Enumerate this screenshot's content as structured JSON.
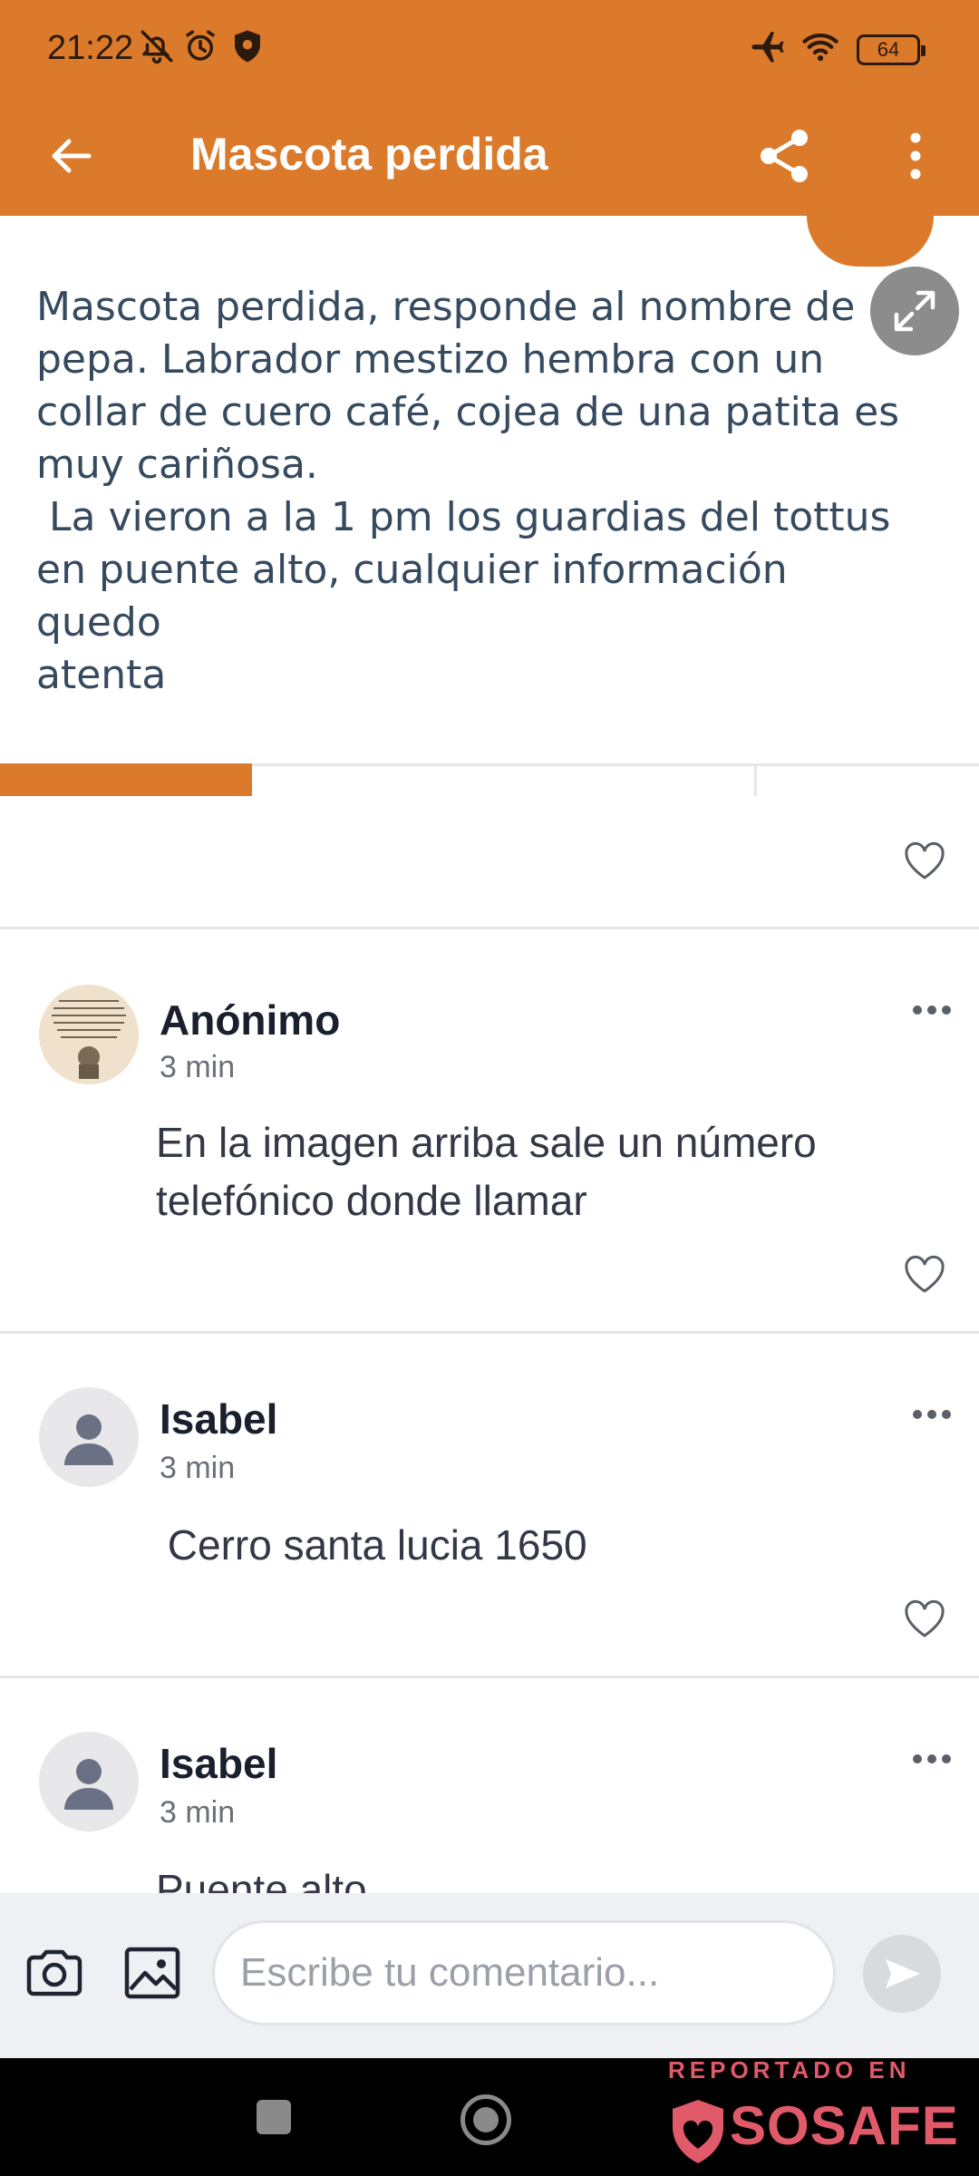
{
  "status_bar": {
    "time": "21:22",
    "battery": "64",
    "icons": [
      "bell-off-icon",
      "alarm-icon",
      "shield-icon",
      "airplane-icon",
      "wifi-icon",
      "battery-icon"
    ]
  },
  "toolbar": {
    "title": "Mascota perdida",
    "back_icon": "arrow-left-icon",
    "share_icon": "share-icon",
    "more_icon": "more-vertical-icon"
  },
  "post": {
    "text": "Mascota perdida, responde al nombre de\npepa. Labrador mestizo hembra con un\ncollar de cuero café, cojea de una patita es\nmuy cariñosa.\n La vieron a la 1 pm los guardias del tottus\nen puente alto, cualquier información quedo\natenta",
    "expand_icon": "expand-icon",
    "like_icon": "heart-outline-icon"
  },
  "comments": [
    {
      "author": "Anónimo",
      "time": "3 min",
      "body": "En la imagen arriba sale un número\ntelefónico donde llamar",
      "avatar": "image-avatar"
    },
    {
      "author": "Isabel",
      "time": "3 min",
      "body": " Cerro santa lucia 1650",
      "avatar": "default-user-avatar"
    },
    {
      "author": "Isabel",
      "time": "3 min",
      "body": "Puente alto",
      "avatar": "default-user-avatar"
    }
  ],
  "composer": {
    "placeholder": "Escribe tu comentario...",
    "camera_icon": "camera-icon",
    "gallery_icon": "image-icon",
    "send_icon": "send-icon"
  },
  "watermark": {
    "top": "REPORTADO EN",
    "brand": "SOSAFE"
  },
  "colors": {
    "accent": "#dc7a2b",
    "watermark": "#e05a6a"
  }
}
